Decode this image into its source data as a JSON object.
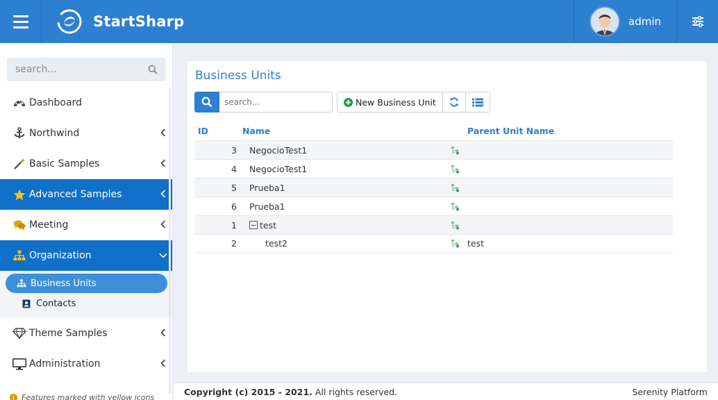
{
  "header": {
    "brand": "StartSharp",
    "user_name": "admin",
    "colors": {
      "bar": "#2d7fd0",
      "active": "#0f6fc9"
    }
  },
  "sidebar": {
    "search_placeholder": "search...",
    "items": [
      {
        "label": "Dashboard",
        "icon": "dashboard-icon"
      },
      {
        "label": "Northwind",
        "icon": "anchor-icon"
      },
      {
        "label": "Basic Samples",
        "icon": "magic-wand-icon"
      },
      {
        "label": "Advanced Samples",
        "icon": "star-icon"
      },
      {
        "label": "Meeting",
        "icon": "comments-icon"
      },
      {
        "label": "Organization",
        "icon": "sitemap-icon"
      },
      {
        "label": "Theme Samples",
        "icon": "diamond-icon"
      },
      {
        "label": "Administration",
        "icon": "desktop-icon"
      }
    ],
    "sub_items": [
      {
        "label": "Business Units",
        "icon": "sitemap-icon"
      },
      {
        "label": "Contacts",
        "icon": "contact-card-icon"
      }
    ],
    "note": "Features marked with yellow icons"
  },
  "page": {
    "title": "Business Units",
    "search_placeholder": "search...",
    "new_button": "New Business Unit"
  },
  "grid": {
    "columns": [
      "ID",
      "Name",
      "Parent Unit Name"
    ],
    "rows": [
      {
        "id": "3",
        "name": "NegocioTest1",
        "parent": ""
      },
      {
        "id": "4",
        "name": "NegocioTest1",
        "parent": ""
      },
      {
        "id": "5",
        "name": "Prueba1",
        "parent": ""
      },
      {
        "id": "6",
        "name": "Prueba1",
        "parent": ""
      },
      {
        "id": "1",
        "name": "test",
        "parent": ""
      },
      {
        "id": "2",
        "name": "test2",
        "parent": "test"
      }
    ]
  },
  "footer": {
    "copyright_bold": "Copyright (c) 2015 - 2021.",
    "copyright_rest": " All rights reserved.",
    "platform": "Serenity Platform"
  }
}
